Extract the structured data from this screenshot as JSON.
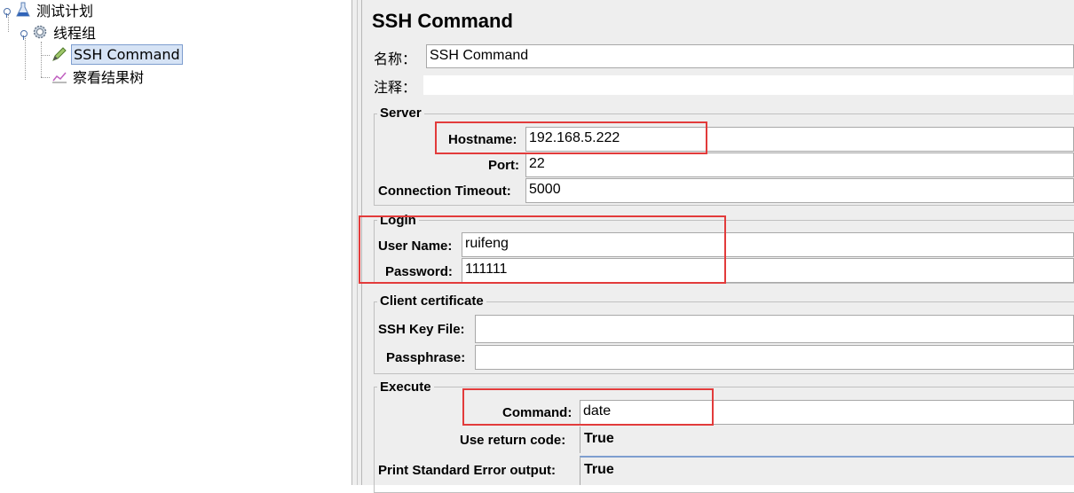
{
  "tree": {
    "items": [
      {
        "label": "测试计划",
        "icon": "flask-icon"
      },
      {
        "label": "线程组",
        "icon": "gear-icon"
      },
      {
        "label": "SSH Command",
        "icon": "pen-icon",
        "selected": true
      },
      {
        "label": "察看结果树",
        "icon": "chart-icon"
      }
    ]
  },
  "panel": {
    "title": "SSH Command",
    "name_label": "名称：",
    "name_value": "SSH Command",
    "comment_label": "注释：",
    "comment_value": "",
    "server": {
      "legend": "Server",
      "hostname_label": "Hostname:",
      "hostname_value": "192.168.5.222",
      "port_label": "Port:",
      "port_value": "22",
      "timeout_label": "Connection Timeout:",
      "timeout_value": "5000"
    },
    "login": {
      "legend": "Login",
      "username_label": "User Name:",
      "username_value": "ruifeng",
      "password_label": "Password:",
      "password_value": "111111"
    },
    "cert": {
      "legend": "Client certificate",
      "keyfile_label": "SSH Key File:",
      "keyfile_value": "",
      "passphrase_label": "Passphrase:",
      "passphrase_value": ""
    },
    "execute": {
      "legend": "Execute",
      "command_label": "Command:",
      "command_value": "date",
      "return_code_label": "Use return code:",
      "return_code_value": "True",
      "stderr_label": "Print Standard Error output:",
      "stderr_value": "True"
    }
  },
  "colors": {
    "highlight": "#e23b3b",
    "selection": "#d6e3f5",
    "panel_bg": "#eeeeee"
  }
}
